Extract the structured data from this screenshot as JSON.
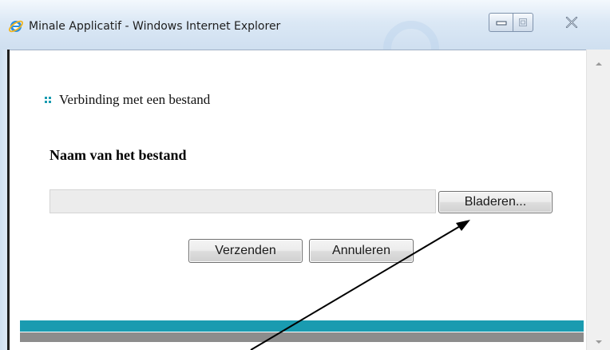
{
  "window": {
    "title": "Minale Applicatif - Windows Internet Explorer",
    "icon": "internet-explorer-icon",
    "controls": [
      "minimize-icon",
      "maximize-icon",
      "close-icon"
    ]
  },
  "page": {
    "heading": "Verbinding met een bestand",
    "heading_bullet_color": "#1a9bb0",
    "file_label": "Naam van het bestand",
    "file_path_value": "",
    "browse_label": "Bladeren...",
    "send_label": "Verzenden",
    "cancel_label": "Annuleren"
  },
  "footer": {
    "band_primary_color": "#1a9bb0",
    "band_secondary_color": "#8c8c8c"
  },
  "annotation": {
    "type": "arrow",
    "points_to": "browse-button",
    "color": "#000000"
  }
}
